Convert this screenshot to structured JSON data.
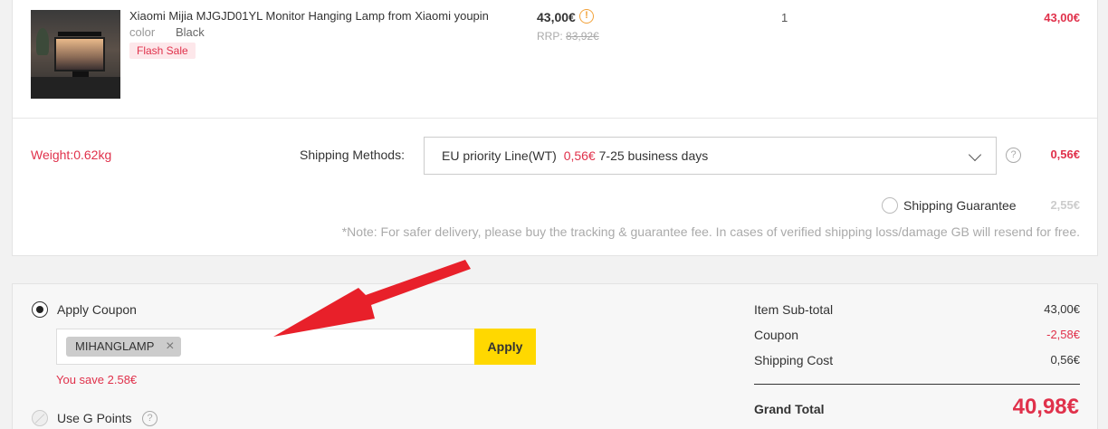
{
  "product": {
    "name": "Xiaomi Mijia MJGJD01YL Monitor Hanging Lamp from Xiaomi youpin",
    "color_label": "color",
    "color_value": "Black",
    "badge": "Flash Sale",
    "price": "43,00€",
    "warning_icon": "exclamation-circle-icon",
    "rrp_label": "RRP:",
    "rrp_value": "83,92€",
    "quantity": "1",
    "line_total": "43,00€"
  },
  "shipping": {
    "weight": "Weight:0.62kg",
    "methods_label": "Shipping Methods:",
    "selected_method": "EU priority Line(WT)",
    "selected_cost": "0,56€",
    "selected_days": "7-25 business days",
    "help_icon": "question-circle-icon",
    "cost": "0,56€",
    "guarantee_label": "Shipping Guarantee",
    "guarantee_cost": "2,55€",
    "note": "*Note: For safer delivery, please buy the tracking & guarantee fee. In cases of verified shipping loss/damage GB will resend for free."
  },
  "coupon": {
    "option_label": "Apply Coupon",
    "code": "MIHANGLAMP",
    "apply_label": "Apply",
    "save_text": "You save 2.58€",
    "gpoints_label": "Use G Points"
  },
  "summary": {
    "subtotal_label": "Item Sub-total",
    "subtotal_value": "43,00€",
    "coupon_label": "Coupon",
    "coupon_value": "-2,58€",
    "shipping_label": "Shipping Cost",
    "shipping_value": "0,56€",
    "grand_total_label": "Grand Total",
    "grand_total_value": "40,98€"
  },
  "colors": {
    "accent_red": "#e0314b",
    "apply_yellow": "#ffd800",
    "warning_orange": "#f2a23a"
  }
}
